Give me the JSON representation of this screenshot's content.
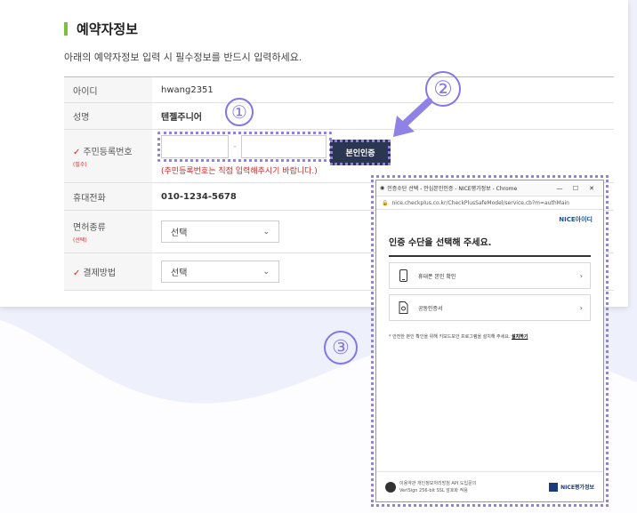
{
  "section": {
    "title": "예약자정보",
    "description": "아래의 예약자정보 입력 시 필수정보를 반드시 입력하세요."
  },
  "form": {
    "rows": [
      {
        "label": "아이디",
        "value": "hwang2351"
      },
      {
        "label": "성명",
        "value": "텐젤주니어"
      },
      {
        "label": "주민등록번호",
        "sub": "(필수)",
        "required": true,
        "separator": "-",
        "note": "(주민등록번호는 직접 입력해주시기 바랍니다.)"
      },
      {
        "label": "휴대전화",
        "value": "010-1234-5678"
      },
      {
        "label": "면허종류",
        "sub": "(선택)",
        "select": "선택"
      },
      {
        "label": "결제방법",
        "required": true,
        "select": "선택"
      }
    ],
    "verify_button": "본인인증",
    "required_mark": "✓"
  },
  "annotations": {
    "one": "①",
    "two": "②",
    "three": "③"
  },
  "popup": {
    "window_title": "인증수단 선택 - 안심본인인증 - NICE평가정보 - Chrome",
    "url": "nice.checkplus.co.kr/CheckPlusSafeModel/service.cb?m=authMain",
    "logo": "NICE아이디",
    "heading": "인증 수단을 선택해 주세요.",
    "options": [
      {
        "label": "휴대폰 본인 확인",
        "icon": "phone-icon"
      },
      {
        "label": "공동인증서",
        "icon": "certificate-icon"
      }
    ],
    "note": "* 안전한 본인 확인을 위해 키보드보안 프로그램을 설치해 주세요.",
    "install_link": "설치하기",
    "footer_line1": "이용약관  개인정보처리방침  API 도입문의",
    "footer_line2": "VeriSign 256-bit SSL 암호화 적용",
    "footer_brand": "NICE평가정보",
    "controls": {
      "min": "—",
      "max": "☐",
      "close": "✕"
    }
  },
  "colors": {
    "accent": "#8f81e6",
    "required": "#d42a2a",
    "button": "#2b3650",
    "title_bar": "#7dbf3f"
  }
}
